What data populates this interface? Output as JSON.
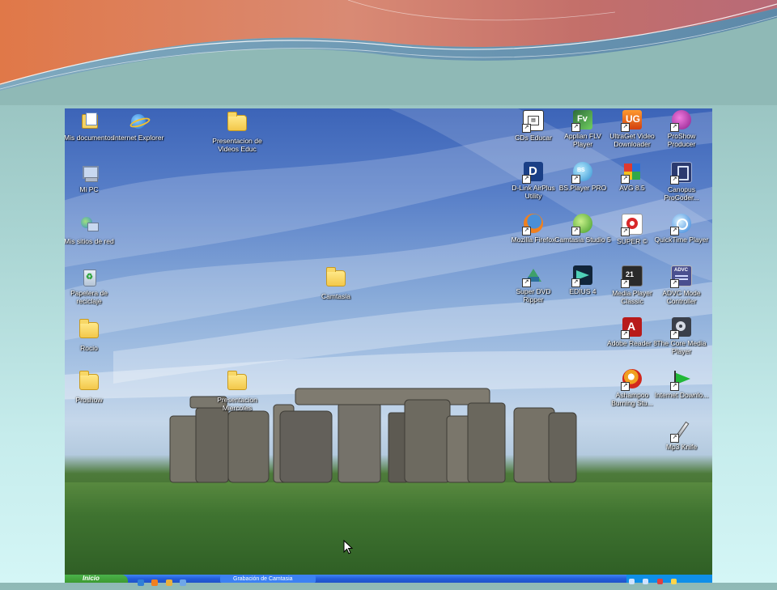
{
  "desktop": {
    "icons_left": [
      {
        "label": "Mis documentos",
        "icon": "my-documents-icon"
      },
      {
        "label": "Internet Explorer",
        "icon": "internet-explorer-icon"
      },
      {
        "label": "Presentacion de Videos Educ",
        "icon": "folder-icon"
      },
      {
        "label": "Mi PC",
        "icon": "my-computer-icon"
      },
      {
        "label": "Mis sitios de red",
        "icon": "network-places-icon"
      },
      {
        "label": "Papelera de reciclaje",
        "icon": "recycle-bin-icon"
      },
      {
        "label": "Camtasia",
        "icon": "folder-icon"
      },
      {
        "label": "Rocio",
        "icon": "folder-icon"
      },
      {
        "label": "Proshow",
        "icon": "folder-icon"
      },
      {
        "label": "Presentacion Miercoles",
        "icon": "folder-icon"
      }
    ],
    "icons_right": [
      {
        "label": "CDs Educar",
        "icon": "cds-educar-icon"
      },
      {
        "label": "Applian FLV Player",
        "icon": "flv-player-icon"
      },
      {
        "label": "UltraGet Video Downloader",
        "icon": "ultraget-icon"
      },
      {
        "label": "ProShow Producer",
        "icon": "proshow-producer-icon"
      },
      {
        "label": "D-Link AirPlus Utility",
        "icon": "dlink-icon"
      },
      {
        "label": "BS.Player PRO",
        "icon": "bsplayer-icon"
      },
      {
        "label": "AVG 8.5",
        "icon": "avg-icon"
      },
      {
        "label": "Canopus ProCoder...",
        "icon": "procoder-icon"
      },
      {
        "label": "Mozilla Firefox",
        "icon": "firefox-icon"
      },
      {
        "label": "Camtasia Studio 5",
        "icon": "camtasia-studio-icon"
      },
      {
        "label": "SUPER ©",
        "icon": "super-icon"
      },
      {
        "label": "QuickTime Player",
        "icon": "quicktime-icon"
      },
      {
        "label": "Super DVD Ripper",
        "icon": "dvd-ripper-icon"
      },
      {
        "label": "EDIUS 4",
        "icon": "edius-icon"
      },
      {
        "label": "Media Player Classic",
        "icon": "media-player-classic-icon"
      },
      {
        "label": "ADVC Mode Controller",
        "icon": "advc-icon"
      },
      {
        "label": "Adobe Reader 8",
        "icon": "adobe-reader-icon"
      },
      {
        "label": "The Core Media Player",
        "icon": "core-media-player-icon"
      },
      {
        "label": "Ashampoo Burning Stu...",
        "icon": "ashampoo-icon"
      },
      {
        "label": "Internet Downlo...",
        "icon": "internet-download-icon"
      },
      {
        "label": "Mp3 Knife",
        "icon": "mp3-knife-icon"
      }
    ]
  },
  "taskbar": {
    "start_label": "Inicio",
    "task_label": "Grabación de Camtasia",
    "clock": "",
    "colors": {
      "bar": "#245edb",
      "start": "#3c9a30",
      "tray": "#0f8fe8"
    }
  }
}
